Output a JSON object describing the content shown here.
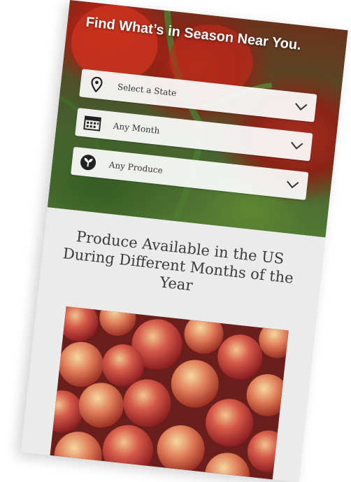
{
  "hero": {
    "title": "Find What’s in Season Near You."
  },
  "filters": {
    "state": {
      "label": "Select a State",
      "icon": "map-pin-icon"
    },
    "month": {
      "label": "Any Month",
      "icon": "calendar-icon"
    },
    "produce": {
      "label": "Any Produce",
      "icon": "sprout-icon"
    }
  },
  "main": {
    "headline": "Produce Available in the US During Different Months of the Year"
  },
  "colors": {
    "dropdown_bg": "#fafafa",
    "content_bg": "#ebebeb",
    "headline_text": "#3a3a3a"
  }
}
